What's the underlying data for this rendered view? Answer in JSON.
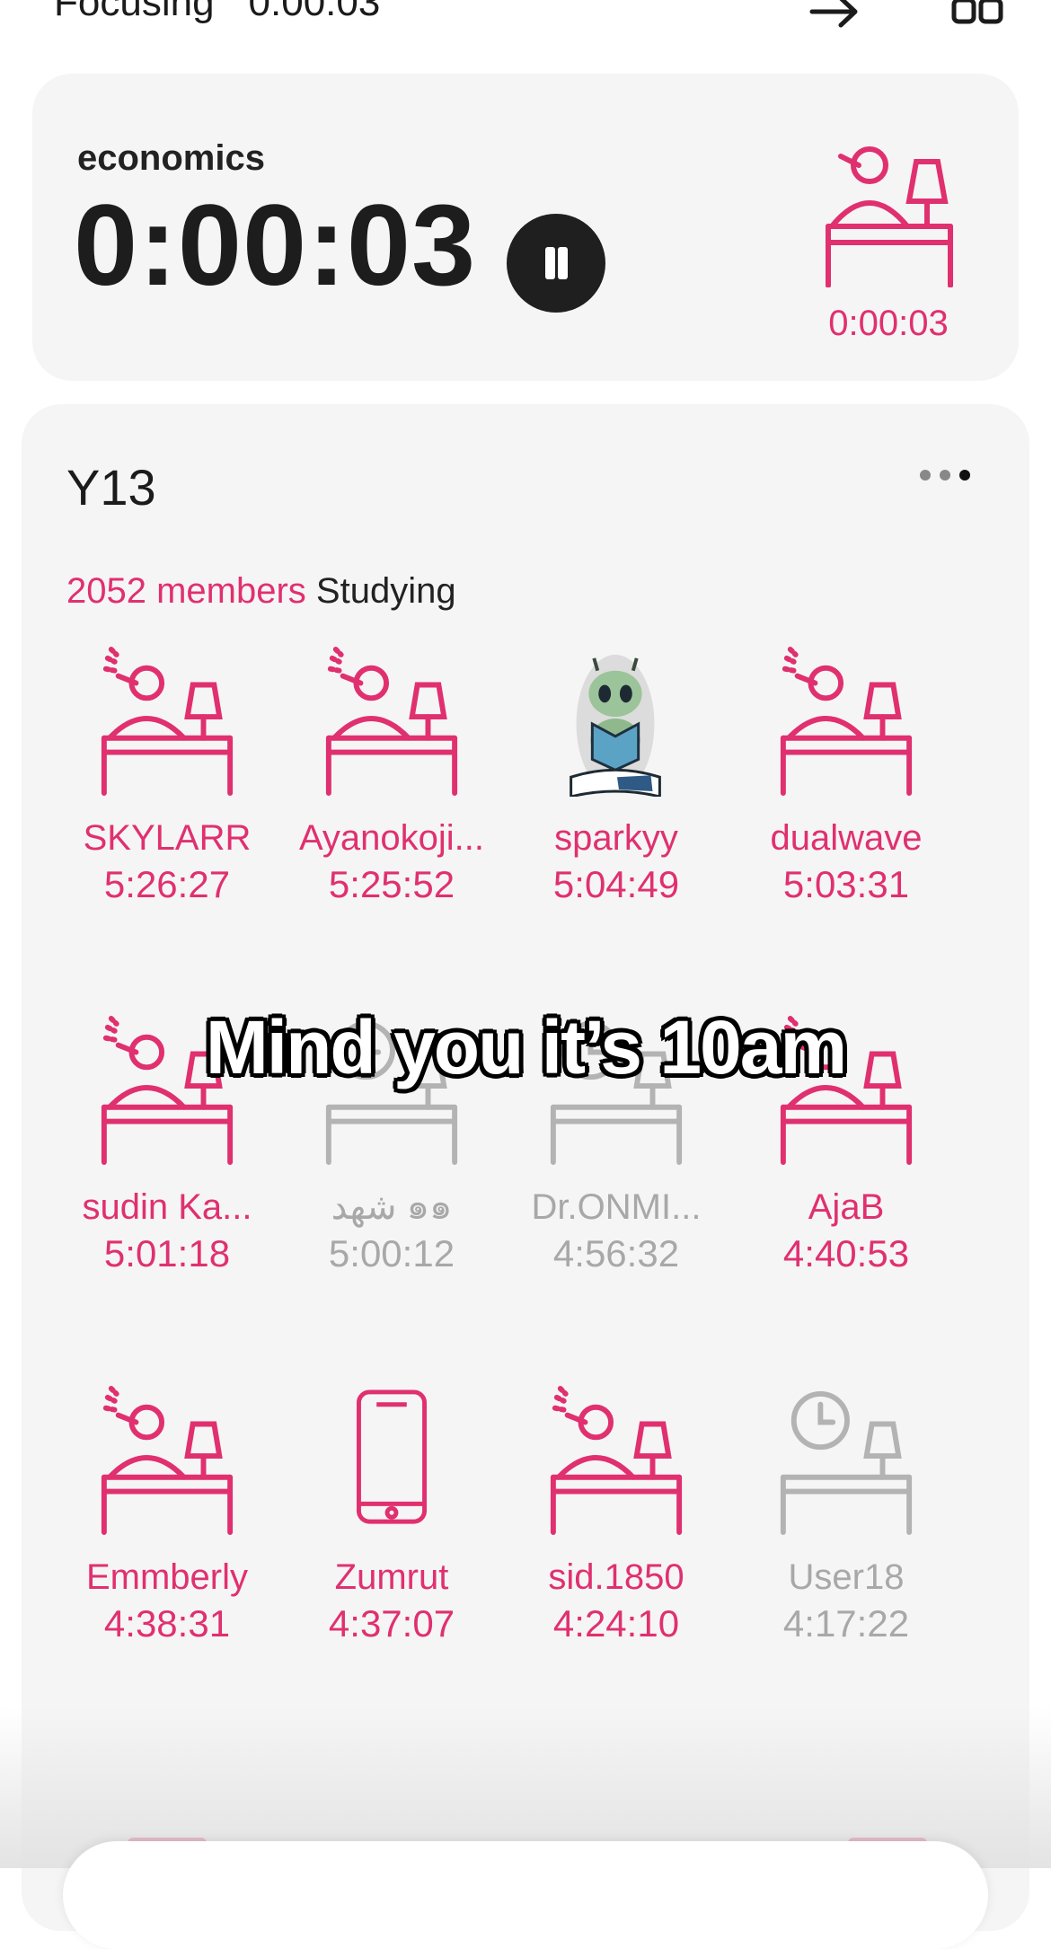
{
  "status_bar": {
    "label": "Focusing",
    "timer": "0:00:03"
  },
  "focus": {
    "subject": "economics",
    "timer": "0:00:03",
    "mini_timer": "0:00:03"
  },
  "group": {
    "name": "Y13",
    "members_count": "2052 members",
    "members_status": "Studying",
    "members": [
      {
        "name": "SKYLARR",
        "time": "5:26:27",
        "icon": "studying-desk-icon",
        "active": true
      },
      {
        "name": "Ayanokoji...",
        "time": "5:25:52",
        "icon": "studying-desk-icon",
        "active": true
      },
      {
        "name": "sparkyy",
        "time": "5:04:49",
        "icon": "alien-reading-avatar",
        "active": true
      },
      {
        "name": "dualwave",
        "time": "5:03:31",
        "icon": "studying-desk-icon",
        "active": true
      },
      {
        "name": "sudin Ka...",
        "time": "5:01:18",
        "icon": "studying-desk-icon",
        "active": true
      },
      {
        "name": "شهد ๑๑",
        "time": "5:00:12",
        "icon": "idle-desk-clock-icon",
        "active": false
      },
      {
        "name": "Dr.ONMI...",
        "time": "4:56:32",
        "icon": "idle-desk-clock-icon",
        "active": false
      },
      {
        "name": "AjaB",
        "time": "4:40:53",
        "icon": "studying-desk-icon",
        "active": true
      },
      {
        "name": "Emmberly",
        "time": "4:38:31",
        "icon": "studying-desk-icon",
        "active": true
      },
      {
        "name": "Zumrut",
        "time": "4:37:07",
        "icon": "phone-icon",
        "active": true
      },
      {
        "name": "sid.1850",
        "time": "4:24:10",
        "icon": "studying-desk-icon",
        "active": true
      },
      {
        "name": "User18",
        "time": "4:17:22",
        "icon": "idle-desk-clock-icon",
        "active": false
      }
    ]
  },
  "caption": "Mind you it’s 10am",
  "colors": {
    "accent": "#e0306f",
    "idle": "#a8a8a8",
    "card": "#f5f5f5"
  }
}
